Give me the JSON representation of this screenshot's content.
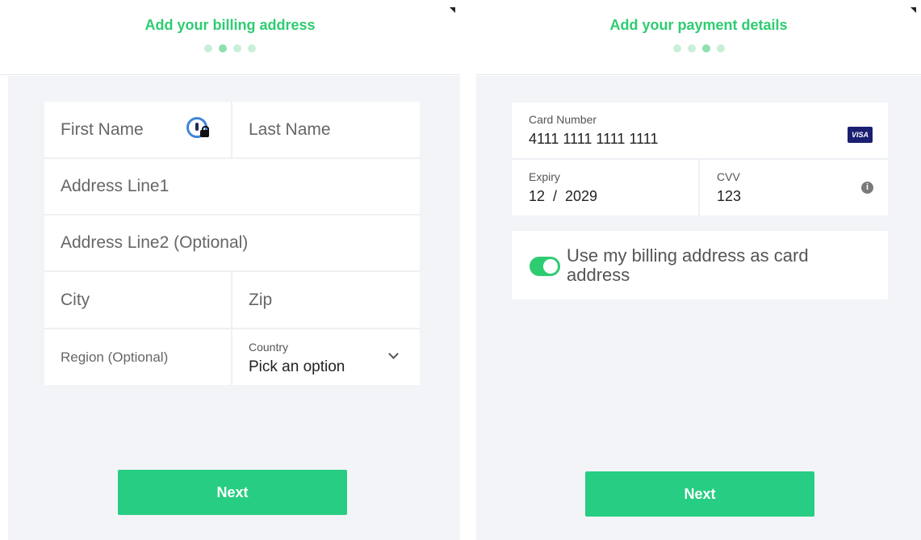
{
  "billing": {
    "title": "Add your billing address",
    "steps_total": 4,
    "steps_active": 2,
    "first_name_placeholder": "First Name",
    "last_name_placeholder": "Last Name",
    "address1_placeholder": "Address Line1",
    "address2_placeholder": "Address Line2 (Optional)",
    "city_placeholder": "City",
    "zip_placeholder": "Zip",
    "region_placeholder": "Region (Optional)",
    "country_label": "Country",
    "country_value": "Pick an option",
    "next_label": "Next"
  },
  "payment": {
    "title": "Add your payment details",
    "steps_total": 4,
    "steps_active": 3,
    "card_number_label": "Card Number",
    "card_number_value": "4111 1111 1111 1111",
    "card_brand": "VISA",
    "expiry_label": "Expiry",
    "expiry_value": "12  /  2029",
    "cvv_label": "CVV",
    "cvv_value": "123",
    "use_billing_label": "Use my billing address as card address",
    "use_billing_on": true,
    "next_label": "Next"
  },
  "icons": {
    "password_manager": "password-manager-lock-icon",
    "card_brand": "visa-icon",
    "cvv_info": "info-icon",
    "country_dropdown": "chevron-down-icon"
  },
  "colors": {
    "accent": "#2ecc71",
    "button": "#27cd82",
    "background": "#f3f4f8"
  }
}
